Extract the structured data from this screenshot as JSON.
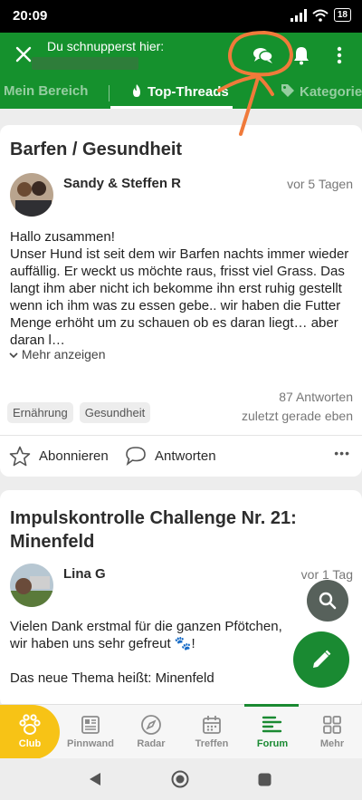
{
  "status_bar": {
    "time": "20:09",
    "battery": "18"
  },
  "app_bar": {
    "title": "Du schnupperst hier:"
  },
  "tabs": {
    "my_area": "Mein Bereich",
    "top_threads": "Top-Threads",
    "categories": "Kategorie"
  },
  "posts": [
    {
      "title": "Barfen / Gesundheit",
      "author": "Sandy & Steffen R",
      "date": "vor 5 Tagen",
      "body": "Hallo zusammen!\nUnser Hund ist seit dem wir Barfen nachts immer wieder auffällig. Er weckt us möchte raus, frisst viel Grass. Das langt ihm aber nicht ich bekomme ihn erst ruhig gestellt wenn ich ihm was zu essen gebe.. wir haben die Futter Menge erhöht um zu schauen ob es daran liegt… aber daran l…",
      "show_more": "Mehr anzeigen",
      "tags": [
        "Ernährung",
        "Gesundheit"
      ],
      "replies": "87 Antworten",
      "last_activity": "zuletzt gerade eben",
      "subscribe": "Abonnieren",
      "reply": "Antworten",
      "more_options": "•••"
    },
    {
      "title": "Impulskontrolle Challenge Nr. 21: Minenfeld",
      "author": "Lina G",
      "date": "vor 1 Tag",
      "body": "Vielen Dank erstmal für die ganzen Pfötchen, wir haben uns sehr gefreut 🐾!\n\nDas neue Thema heißt: Minenfeld"
    }
  ],
  "bottom_nav": [
    {
      "label": "Club",
      "icon": "paw-icon"
    },
    {
      "label": "Pinnwand",
      "icon": "newspaper-icon"
    },
    {
      "label": "Radar",
      "icon": "compass-icon"
    },
    {
      "label": "Treffen",
      "icon": "calendar-icon"
    },
    {
      "label": "Forum",
      "icon": "forum-icon"
    },
    {
      "label": "Mehr",
      "icon": "grid-icon"
    }
  ],
  "colors": {
    "primary": "#15912d",
    "club": "#f7c316",
    "annotation": "#f07a3a"
  }
}
